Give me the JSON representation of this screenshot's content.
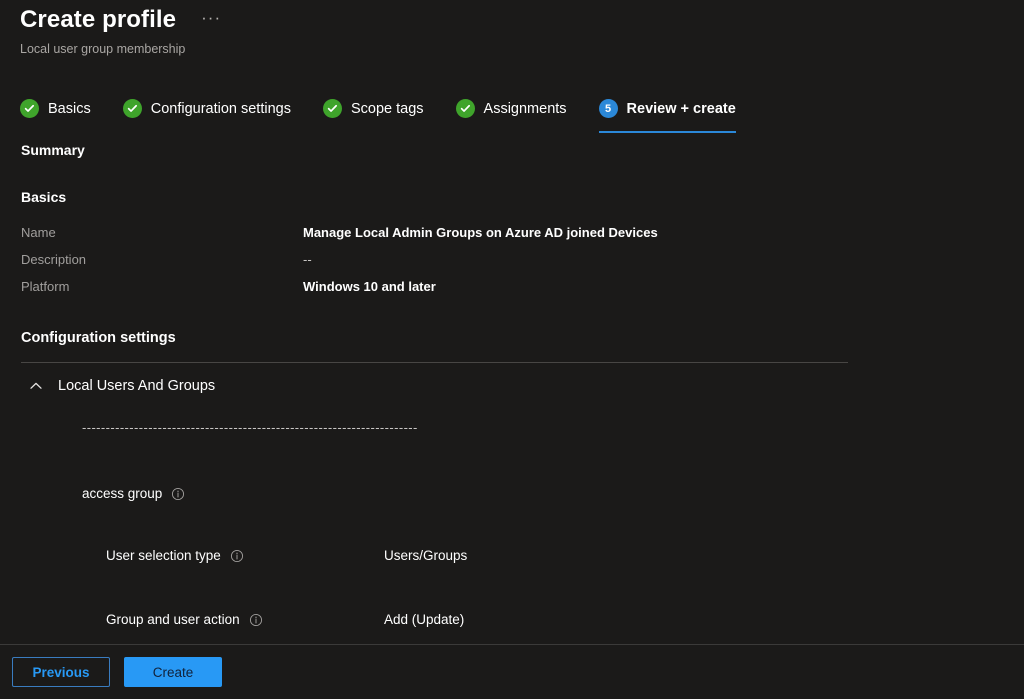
{
  "header": {
    "title": "Create profile",
    "subtitle": "Local user group membership",
    "more_menu": "···"
  },
  "wizard": {
    "tabs": [
      {
        "label": "Basics",
        "state": "done",
        "badge": "✓"
      },
      {
        "label": "Configuration settings",
        "state": "done",
        "badge": "✓"
      },
      {
        "label": "Scope tags",
        "state": "done",
        "badge": "✓"
      },
      {
        "label": "Assignments",
        "state": "done",
        "badge": "✓"
      },
      {
        "label": "Review + create",
        "state": "active",
        "badge": "5"
      }
    ]
  },
  "summary": {
    "heading": "Summary",
    "basics": {
      "heading": "Basics",
      "rows": [
        {
          "key": "Name",
          "value": "Manage Local Admin Groups on Azure AD joined Devices"
        },
        {
          "key": "Description",
          "value": "--"
        },
        {
          "key": "Platform",
          "value": "Windows 10 and later"
        }
      ]
    },
    "configuration_settings": {
      "heading": "Configuration settings",
      "group": {
        "label": "Local Users And Groups",
        "collapse_icon": "chevron-up-icon",
        "separator": "-----------------------------------------------------------------------",
        "policy_label": "access group",
        "settings": [
          {
            "name": "User selection type",
            "value": "Users/Groups"
          },
          {
            "name": "Group and user action",
            "value": "Add (Update)"
          }
        ]
      }
    }
  },
  "footer": {
    "previous_label": "Previous",
    "create_label": "Create"
  },
  "colors": {
    "background": "#1b1a19",
    "accent": "#2899f5",
    "success": "#3fa42b",
    "active_step": "#2b88d8",
    "muted_text": "#a19f9d",
    "divider": "#484644"
  }
}
